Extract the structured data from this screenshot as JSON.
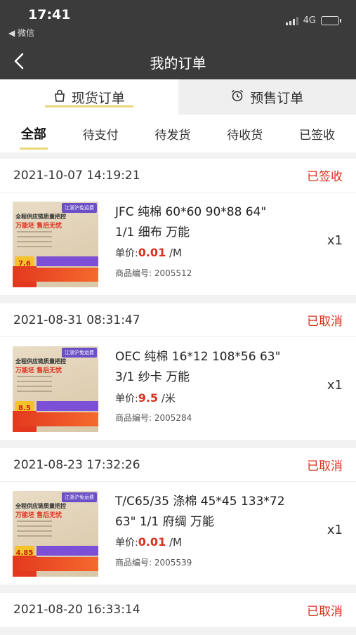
{
  "status_bar": {
    "time": "17:41",
    "back_app": "◀ 微信",
    "network": "4G"
  },
  "header": {
    "title": "我的订单"
  },
  "mode_tabs": [
    {
      "label": "现货订单",
      "icon": "bag-icon",
      "active": true
    },
    {
      "label": "预售订单",
      "icon": "alarm-clock-icon",
      "active": false
    }
  ],
  "filters": [
    {
      "label": "全部",
      "active": true
    },
    {
      "label": "待支付",
      "active": false
    },
    {
      "label": "待发货",
      "active": false
    },
    {
      "label": "待收货",
      "active": false
    },
    {
      "label": "已签收",
      "active": false
    }
  ],
  "colors": {
    "accent": "#e8d77a",
    "status_red": "#d9301f",
    "topbar": "#3b3b3b"
  },
  "labels": {
    "price_prefix": "单价:",
    "code_prefix": "商品编号: "
  },
  "orders": [
    {
      "date": "2021-10-07 14:19:21",
      "status": "已签收",
      "title_line1": "JFC 纯棉 60*60 90*88 64\"",
      "title_line2": "1/1 细布 万能",
      "price": "0.01",
      "unit": " /M",
      "code": "2005512",
      "qty": "x1",
      "thumb_price": "7.6"
    },
    {
      "date": "2021-08-31 08:31:47",
      "status": "已取消",
      "title_line1": "OEC 纯棉 16*12 108*56 63\"",
      "title_line2": "3/1 纱卡 万能",
      "price": "9.5",
      "unit": " /米",
      "code": "2005284",
      "qty": "x1",
      "thumb_price": "8.5"
    },
    {
      "date": "2021-08-23 17:32:26",
      "status": "已取消",
      "title_line1": "T/C65/35 涤棉 45*45 133*72",
      "title_line2": "63\" 1/1 府绸 万能",
      "price": "0.01",
      "unit": " /M",
      "code": "2005539",
      "qty": "x1",
      "thumb_price": "4.85"
    },
    {
      "date": "2021-08-20 16:33:14",
      "status": "已取消"
    }
  ],
  "thumb_text": {
    "ribbon": "江浙沪免运费",
    "line1": "全程供应链质量把控",
    "line2": "万能坯 售后无忧",
    "purple": "联系客服免费取样布",
    "red": "爆款现货 长期供应"
  }
}
